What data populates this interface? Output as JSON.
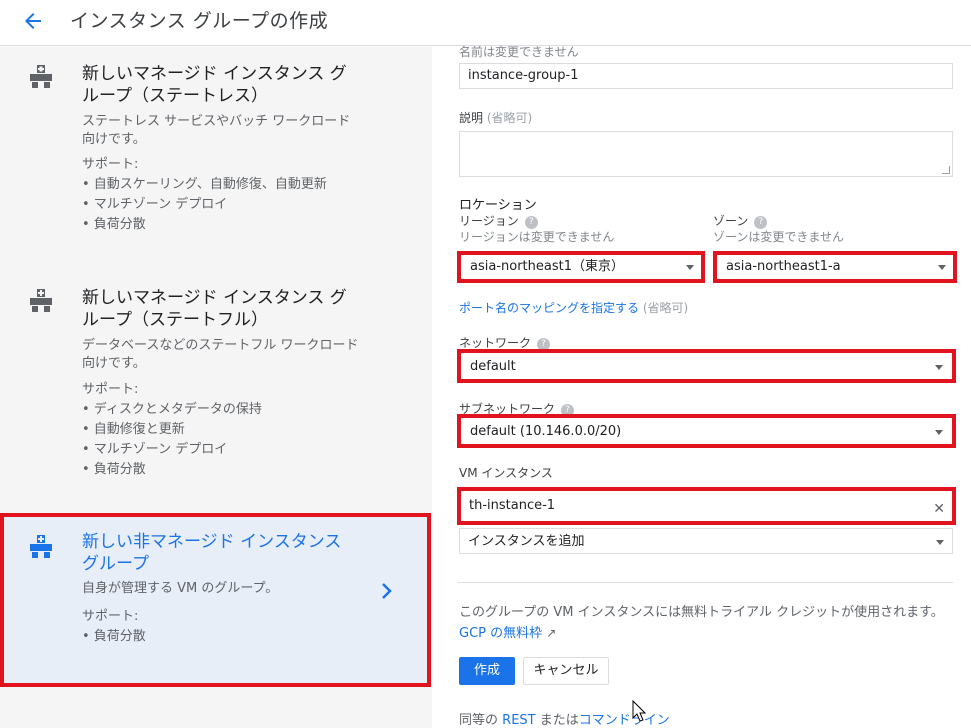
{
  "header": {
    "title": "インスタンス グループの作成"
  },
  "options": [
    {
      "title": "新しいマネージド インスタンス グループ（ステートレス）",
      "desc": "ステートレス サービスやバッチ ワークロード向けです。",
      "support_label": "サポート:",
      "features": [
        "• 自動スケーリング、自動修復、自動更新",
        "• マルチゾーン デプロイ",
        "• 負荷分散"
      ]
    },
    {
      "title": "新しいマネージド インスタンス グループ（ステートフル）",
      "desc": "データベースなどのステートフル ワークロード向けです。",
      "support_label": "サポート:",
      "features": [
        "• ディスクとメタデータの保持",
        "• 自動修復と更新",
        "• マルチゾーン デプロイ",
        "• 負荷分散"
      ]
    },
    {
      "title": "新しい非マネージド インスタンス グループ",
      "desc": "自身が管理する VM のグループ。",
      "support_label": "サポート:",
      "features": [
        "• 負荷分散"
      ]
    }
  ],
  "form": {
    "name_note": "名前は変更できません",
    "name_value": "instance-group-1",
    "description_label": "説明",
    "optional": "(省略可)",
    "location_label": "ロケーション",
    "region_label": "リージョン",
    "region_note": "リージョンは変更できません",
    "region_value": "asia-northeast1（東京）",
    "zone_label": "ゾーン",
    "zone_note": "ゾーンは変更できません",
    "zone_value": "asia-northeast1-a",
    "port_mapping_link": "ポート名のマッピングを指定する",
    "network_label": "ネットワーク",
    "network_value": "default",
    "subnet_label": "サブネットワーク",
    "subnet_value": "default (10.146.0.0/20)",
    "vm_label": "VM インスタンス",
    "vm_value": "th-instance-1",
    "add_instance": "インスタンスを追加",
    "trial_text": "このグループの VM インスタンスには無料トライアル クレジットが使用されます。",
    "trial_link": "GCP の無料枠",
    "create_button": "作成",
    "cancel_button": "キャンセル",
    "equiv_prefix": "同等の",
    "equiv_rest": "REST",
    "equiv_mid": "または",
    "equiv_cmd": "コマンドライン"
  },
  "colors": {
    "accent": "#1a73e8",
    "highlight": "#e0131f",
    "selected_bg": "#e8eef8"
  }
}
